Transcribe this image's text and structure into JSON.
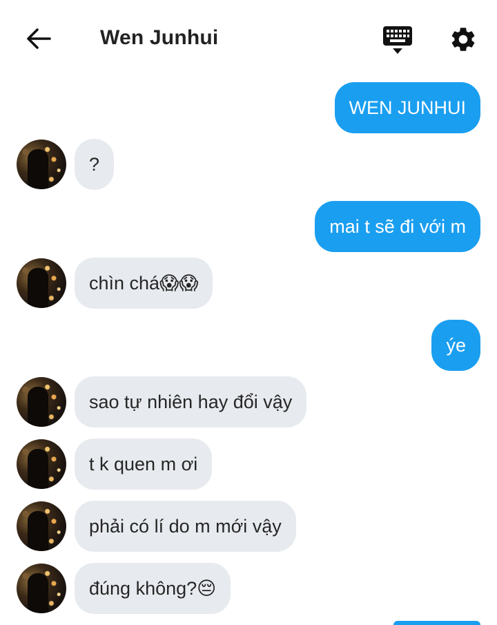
{
  "header": {
    "title": "Wen Junhui",
    "icons": {
      "back": "arrow-left-icon",
      "keyboard": "keyboard-icon",
      "settings": "gear-icon"
    }
  },
  "colors": {
    "outgoing_bubble": "#1a9ef0",
    "incoming_bubble": "#e7eaee",
    "background": "#ffffff"
  },
  "messages": [
    {
      "dir": "out",
      "text": "WEN JUNHUI"
    },
    {
      "dir": "in",
      "text": "?"
    },
    {
      "dir": "out",
      "text": "mai t sẽ đi với m"
    },
    {
      "dir": "in",
      "text": "chìn chá😱😱"
    },
    {
      "dir": "out",
      "text": "ýe"
    },
    {
      "dir": "in",
      "text": "sao tự nhiên hay đổi vậy"
    },
    {
      "dir": "in",
      "text": "t k quen m ơi"
    },
    {
      "dir": "in",
      "text": "phải có lí do m mới vậy"
    },
    {
      "dir": "in",
      "text": "đúng không?😔"
    }
  ]
}
